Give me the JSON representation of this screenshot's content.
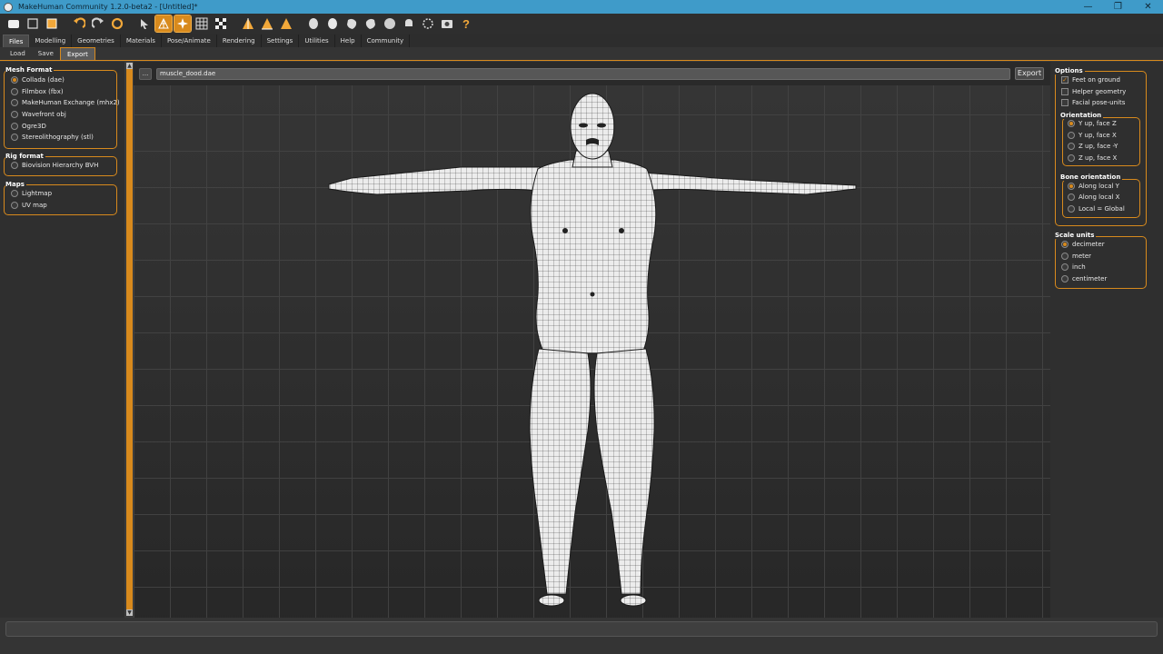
{
  "window": {
    "title": "MakeHuman Community 1.2.0-beta2 - [Untitled]*"
  },
  "toolbar": {
    "icons": [
      "save-file-icon",
      "new-file-icon",
      "export-file-icon",
      "undo-icon",
      "redo-icon",
      "reset-icon",
      "pose-cursor-icon",
      "wireframe-icon",
      "smooth-icon",
      "grid-icon",
      "checker-icon",
      "front-view-icon",
      "side-view-icon",
      "top-view-icon",
      "head-front-icon",
      "head-back-icon",
      "head-left-icon",
      "head-right-icon",
      "head-top-icon",
      "reset-camera-icon",
      "screenshot-icon",
      "help-icon"
    ],
    "active": [
      "wireframe-icon",
      "smooth-icon"
    ]
  },
  "tabs": [
    "Files",
    "Modelling",
    "Geometries",
    "Materials",
    "Pose/Animate",
    "Rendering",
    "Settings",
    "Utilities",
    "Help",
    "Community"
  ],
  "active_tab": "Files",
  "subtabs": [
    "Load",
    "Save",
    "Export"
  ],
  "active_subtab": "Export",
  "file": {
    "dots_label": "...",
    "filename": "muscle_dood.dae",
    "export_label": "Export"
  },
  "left_panel": {
    "mesh_format": {
      "title": "Mesh Format",
      "options": [
        "Collada (dae)",
        "Filmbox (fbx)",
        "MakeHuman Exchange (mhx2)",
        "Wavefront obj",
        "Ogre3D",
        "Stereolithography (stl)"
      ],
      "selected": "Collada (dae)"
    },
    "rig_format": {
      "title": "Rig format",
      "options": [
        "Biovision Hierarchy BVH"
      ]
    },
    "maps": {
      "title": "Maps",
      "options": [
        "Lightmap",
        "UV map"
      ]
    }
  },
  "right_panel": {
    "options": {
      "title": "Options",
      "checkboxes": [
        {
          "label": "Feet on ground",
          "checked": true
        },
        {
          "label": "Helper geometry",
          "checked": false
        },
        {
          "label": "Facial pose-units",
          "checked": false
        }
      ]
    },
    "orientation": {
      "title": "Orientation",
      "options": [
        "Y up, face Z",
        "Y up, face X",
        "Z up, face -Y",
        "Z up, face X"
      ],
      "selected": "Y up, face Z"
    },
    "bone_orientation": {
      "title": "Bone orientation",
      "options": [
        "Along local Y",
        "Along local X",
        "Local = Global"
      ],
      "selected": "Along local Y"
    },
    "scale_units": {
      "title": "Scale units",
      "options": [
        "decimeter",
        "meter",
        "inch",
        "centimeter"
      ],
      "selected": "decimeter"
    }
  },
  "colors": {
    "accent": "#d88a1d",
    "titlebar": "#3f9bc9",
    "panel": "#2f2f2f",
    "mesh": "#e8e8e8"
  }
}
